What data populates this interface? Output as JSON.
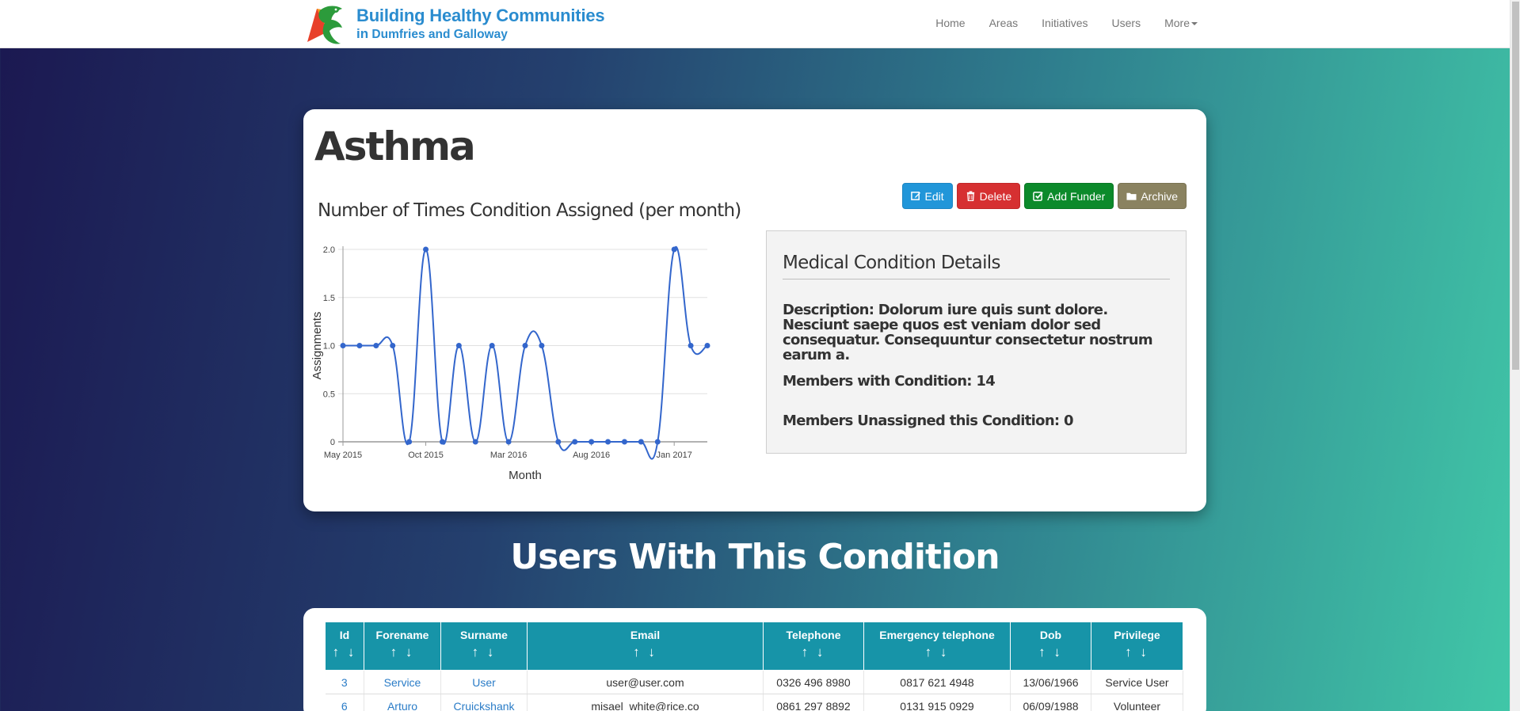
{
  "nav": {
    "brand_title": "Building Healthy Communities",
    "brand_in": "in",
    "brand_sub": "Dumfries and Galloway",
    "links": [
      "Home",
      "Areas",
      "Initiatives",
      "Users"
    ],
    "more": "More"
  },
  "page": {
    "title": "Asthma"
  },
  "buttons": {
    "edit": "Edit",
    "delete": "Delete",
    "add_funder": "Add Funder",
    "archive": "Archive"
  },
  "details": {
    "title": "Medical Condition Details",
    "description": "Description: Dolorum iure quis sunt dolore. Nesciunt saepe quos est veniam dolor sed consequatur. Consequuntur consectetur nostrum earum a.",
    "members": "Members with Condition: 14",
    "unassigned": "Members Unassigned this Condition: 0"
  },
  "chart_data": {
    "type": "line",
    "title": "Number of Times Condition Assigned (per month)",
    "xlabel": "Month",
    "ylabel": "Assignments",
    "x_tick_labels": [
      "May 2015",
      "Oct 2015",
      "Mar 2016",
      "Aug 2016",
      "Jan 2017"
    ],
    "y_tick_labels": [
      "2.0",
      "1.5",
      "1.0",
      "0.5",
      "0"
    ],
    "ylim": [
      0,
      2
    ],
    "x": [
      "2015-05",
      "2015-06",
      "2015-07",
      "2015-08",
      "2015-09",
      "2015-10",
      "2015-11",
      "2015-12",
      "2016-01",
      "2016-02",
      "2016-03",
      "2016-04",
      "2016-05",
      "2016-06",
      "2016-07",
      "2016-08",
      "2016-09",
      "2016-10",
      "2016-11",
      "2016-12",
      "2017-01",
      "2017-02",
      "2017-03"
    ],
    "values": [
      1,
      1,
      1,
      1,
      0,
      2,
      0,
      1,
      0,
      1,
      0,
      1,
      1,
      0,
      0,
      0,
      0,
      0,
      0,
      0,
      2,
      1,
      1
    ],
    "grid": true,
    "color": "#3366cc"
  },
  "section": {
    "heading": "Users With This Condition"
  },
  "table": {
    "columns": [
      "Id",
      "Forename",
      "Surname",
      "Email",
      "Telephone",
      "Emergency telephone",
      "Dob",
      "Privilege"
    ],
    "sort_arrows": "↑ ↓",
    "rows": [
      [
        "3",
        "Service",
        "User",
        "user@user.com",
        "0326 496 8980",
        "0817 621 4948",
        "13/06/1966",
        "Service User"
      ],
      [
        "6",
        "Arturo",
        "Cruickshank",
        "misael_white@rice.co",
        "0861 297 8892",
        "0131 915 0929",
        "06/09/1988",
        "Volunteer"
      ]
    ]
  }
}
